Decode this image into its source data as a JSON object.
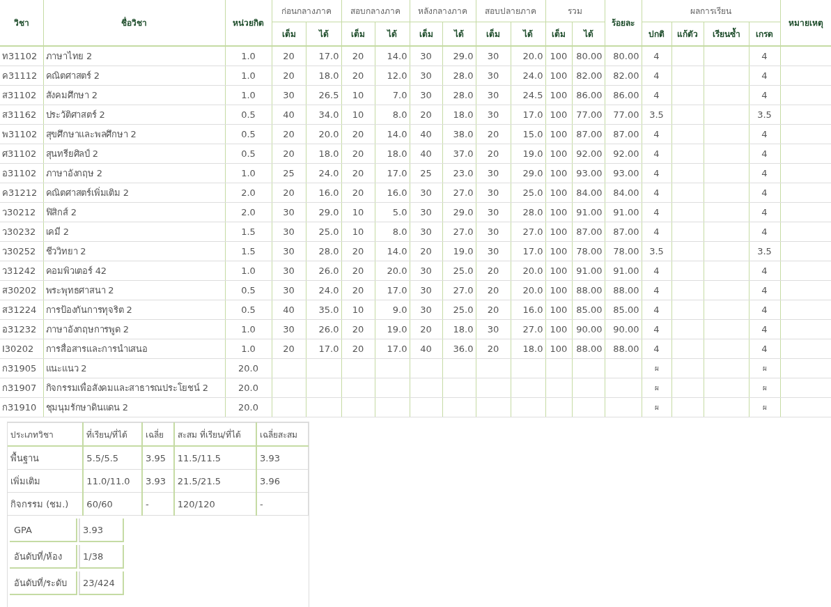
{
  "grades_table": {
    "columns": {
      "code": "วิชา",
      "name": "ชื่อวิชา",
      "credit": "หน่วยกิต",
      "groups": [
        {
          "label": "ก่อนกลางภาค",
          "full": "เต็ม",
          "got": "ได้"
        },
        {
          "label": "สอบกลางภาค",
          "full": "เต็ม",
          "got": "ได้"
        },
        {
          "label": "หลังกลางภาค",
          "full": "เต็ม",
          "got": "ได้"
        },
        {
          "label": "สอบปลายภาค",
          "full": "เต็ม",
          "got": "ได้"
        },
        {
          "label": "รวม",
          "full": "เต็ม",
          "got": "ได้"
        }
      ],
      "percent": "ร้อยละ",
      "result_group": "ผลการเรียน",
      "results": {
        "normal": "ปกติ",
        "retake": "แก้ตัว",
        "repeat": "เรียนซ้ำ",
        "grade": "เกรด"
      },
      "note": "หมายเหตุ"
    },
    "rows": [
      {
        "code": "ท31102",
        "name": "ภาษาไทย  2",
        "credit": "1.0",
        "scores": [
          [
            "20",
            "17.0"
          ],
          [
            "20",
            "14.0"
          ],
          [
            "30",
            "29.0"
          ],
          [
            "30",
            "20.0"
          ],
          [
            "100",
            "80.00"
          ]
        ],
        "percent": "80.00",
        "results": {
          "normal": "4",
          "grade": "4"
        }
      },
      {
        "code": "ค31112",
        "name": "คณิตศาสตร์  2",
        "credit": "1.0",
        "scores": [
          [
            "20",
            "18.0"
          ],
          [
            "20",
            "12.0"
          ],
          [
            "30",
            "28.0"
          ],
          [
            "30",
            "24.0"
          ],
          [
            "100",
            "82.00"
          ]
        ],
        "percent": "82.00",
        "results": {
          "normal": "4",
          "grade": "4"
        }
      },
      {
        "code": "ส31102",
        "name": "สังคมศึกษา  2",
        "credit": "1.0",
        "scores": [
          [
            "30",
            "26.5"
          ],
          [
            "10",
            "7.0"
          ],
          [
            "30",
            "28.0"
          ],
          [
            "30",
            "24.5"
          ],
          [
            "100",
            "86.00"
          ]
        ],
        "percent": "86.00",
        "results": {
          "normal": "4",
          "grade": "4"
        }
      },
      {
        "code": "ส31162",
        "name": "ประวัติศาสตร์  2",
        "credit": "0.5",
        "scores": [
          [
            "40",
            "34.0"
          ],
          [
            "10",
            "8.0"
          ],
          [
            "20",
            "18.0"
          ],
          [
            "30",
            "17.0"
          ],
          [
            "100",
            "77.00"
          ]
        ],
        "percent": "77.00",
        "results": {
          "normal": "3.5",
          "grade": "3.5"
        }
      },
      {
        "code": "พ31102",
        "name": "สุขศึกษาและพลศึกษา  2",
        "credit": "0.5",
        "scores": [
          [
            "20",
            "20.0"
          ],
          [
            "20",
            "14.0"
          ],
          [
            "40",
            "38.0"
          ],
          [
            "20",
            "15.0"
          ],
          [
            "100",
            "87.00"
          ]
        ],
        "percent": "87.00",
        "results": {
          "normal": "4",
          "grade": "4"
        }
      },
      {
        "code": "ศ31102",
        "name": "สุนทรียศิลป์  2",
        "credit": "0.5",
        "scores": [
          [
            "20",
            "18.0"
          ],
          [
            "20",
            "18.0"
          ],
          [
            "40",
            "37.0"
          ],
          [
            "20",
            "19.0"
          ],
          [
            "100",
            "92.00"
          ]
        ],
        "percent": "92.00",
        "results": {
          "normal": "4",
          "grade": "4"
        }
      },
      {
        "code": "อ31102",
        "name": "ภาษาอังกฤษ  2",
        "credit": "1.0",
        "scores": [
          [
            "25",
            "24.0"
          ],
          [
            "20",
            "17.0"
          ],
          [
            "25",
            "23.0"
          ],
          [
            "30",
            "29.0"
          ],
          [
            "100",
            "93.00"
          ]
        ],
        "percent": "93.00",
        "results": {
          "normal": "4",
          "grade": "4"
        }
      },
      {
        "code": "ค31212",
        "name": "คณิตศาสตร์เพิ่มเติม  2",
        "credit": "2.0",
        "scores": [
          [
            "20",
            "16.0"
          ],
          [
            "20",
            "16.0"
          ],
          [
            "30",
            "27.0"
          ],
          [
            "30",
            "25.0"
          ],
          [
            "100",
            "84.00"
          ]
        ],
        "percent": "84.00",
        "results": {
          "normal": "4",
          "grade": "4"
        }
      },
      {
        "code": "ว30212",
        "name": "ฟิสิกส์  2",
        "credit": "2.0",
        "scores": [
          [
            "30",
            "29.0"
          ],
          [
            "10",
            "5.0"
          ],
          [
            "30",
            "29.0"
          ],
          [
            "30",
            "28.0"
          ],
          [
            "100",
            "91.00"
          ]
        ],
        "percent": "91.00",
        "results": {
          "normal": "4",
          "grade": "4"
        }
      },
      {
        "code": "ว30232",
        "name": "เคมี  2",
        "credit": "1.5",
        "scores": [
          [
            "30",
            "25.0"
          ],
          [
            "10",
            "8.0"
          ],
          [
            "30",
            "27.0"
          ],
          [
            "30",
            "27.0"
          ],
          [
            "100",
            "87.00"
          ]
        ],
        "percent": "87.00",
        "results": {
          "normal": "4",
          "grade": "4"
        }
      },
      {
        "code": "ว30252",
        "name": "ชีววิทยา  2",
        "credit": "1.5",
        "scores": [
          [
            "30",
            "28.0"
          ],
          [
            "20",
            "14.0"
          ],
          [
            "20",
            "19.0"
          ],
          [
            "30",
            "17.0"
          ],
          [
            "100",
            "78.00"
          ]
        ],
        "percent": "78.00",
        "results": {
          "normal": "3.5",
          "grade": "3.5"
        }
      },
      {
        "code": "ว31242",
        "name": "คอมพิวเตอร์  42",
        "credit": "1.0",
        "scores": [
          [
            "30",
            "26.0"
          ],
          [
            "20",
            "20.0"
          ],
          [
            "30",
            "25.0"
          ],
          [
            "20",
            "20.0"
          ],
          [
            "100",
            "91.00"
          ]
        ],
        "percent": "91.00",
        "results": {
          "normal": "4",
          "grade": "4"
        }
      },
      {
        "code": "ส30202",
        "name": "พระพุทธศาสนา  2",
        "credit": "0.5",
        "scores": [
          [
            "30",
            "24.0"
          ],
          [
            "20",
            "17.0"
          ],
          [
            "30",
            "27.0"
          ],
          [
            "20",
            "20.0"
          ],
          [
            "100",
            "88.00"
          ]
        ],
        "percent": "88.00",
        "results": {
          "normal": "4",
          "grade": "4"
        }
      },
      {
        "code": "ส31224",
        "name": "การป้องกันการทุจริต  2",
        "credit": "0.5",
        "scores": [
          [
            "40",
            "35.0"
          ],
          [
            "10",
            "9.0"
          ],
          [
            "30",
            "25.0"
          ],
          [
            "20",
            "16.0"
          ],
          [
            "100",
            "85.00"
          ]
        ],
        "percent": "85.00",
        "results": {
          "normal": "4",
          "grade": "4"
        }
      },
      {
        "code": "อ31232",
        "name": "ภาษาอังกฤษการพูด  2",
        "credit": "1.0",
        "scores": [
          [
            "30",
            "26.0"
          ],
          [
            "20",
            "19.0"
          ],
          [
            "20",
            "18.0"
          ],
          [
            "30",
            "27.0"
          ],
          [
            "100",
            "90.00"
          ]
        ],
        "percent": "90.00",
        "results": {
          "normal": "4",
          "grade": "4"
        }
      },
      {
        "code": "I30202",
        "name": "การสื่อสารและการนำเสนอ",
        "credit": "1.0",
        "scores": [
          [
            "20",
            "17.0"
          ],
          [
            "20",
            "17.0"
          ],
          [
            "40",
            "36.0"
          ],
          [
            "20",
            "18.0"
          ],
          [
            "100",
            "88.00"
          ]
        ],
        "percent": "88.00",
        "results": {
          "normal": "4",
          "grade": "4"
        }
      },
      {
        "code": "ก31905",
        "name": "แนะแนว  2",
        "credit": "20.0",
        "results": {
          "normal": "ผ",
          "grade": "ผ"
        }
      },
      {
        "code": "ก31907",
        "name": "กิจกรรมเพื่อสังคมและสาธารณประโยชน์  2",
        "credit": "20.0",
        "results": {
          "normal": "ผ",
          "grade": "ผ"
        }
      },
      {
        "code": "ก31910",
        "name": "ชุมนุมรักษาดินแดน  2",
        "credit": "20.0",
        "results": {
          "normal": "ผ",
          "grade": "ผ"
        }
      }
    ]
  },
  "summary_table": {
    "columns": [
      "ประเภทวิชา",
      "ที่เรียน/ที่ได้",
      "เฉลี่ย",
      "สะสม  ที่เรียน/ที่ได้",
      "เฉลี่ยสะสม"
    ],
    "rows": [
      [
        "พื้นฐาน",
        "5.5/5.5",
        "3.95",
        "11.5/11.5",
        "3.93"
      ],
      [
        "เพิ่มเติม",
        "11.0/11.0",
        "3.93",
        "21.5/21.5",
        "3.96"
      ],
      [
        "กิจกรรม  (ชม.)",
        "60/60",
        "-",
        "120/120",
        "-"
      ]
    ]
  },
  "standing": [
    {
      "label": "GPA",
      "value": "3.93"
    },
    {
      "label": "อันดับที่/ห้อง",
      "value": "1/38"
    },
    {
      "label": "อันดับที่/ระดับ",
      "value": "23/424"
    }
  ]
}
